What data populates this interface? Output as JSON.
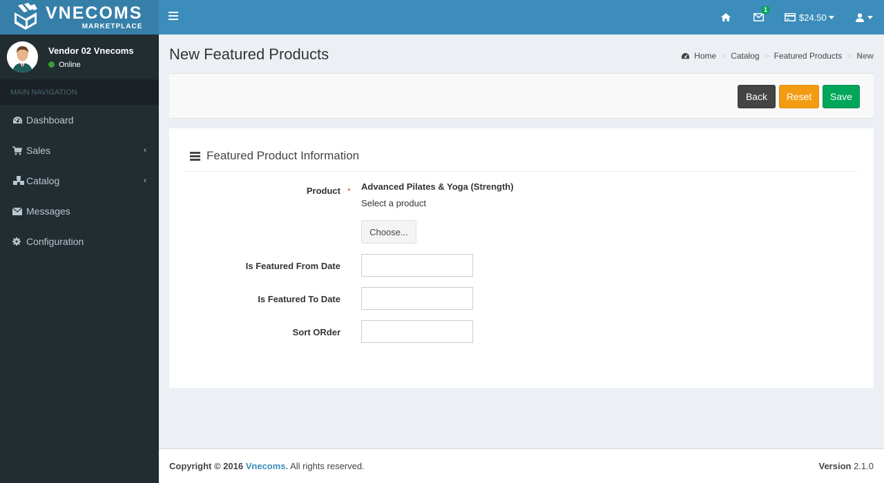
{
  "brand": {
    "title": "VNECOMS",
    "subtitle": "MARKETPLACE"
  },
  "user": {
    "name": "Vendor 02 Vnecoms",
    "status": "Online"
  },
  "sidebar": {
    "header": "MAIN NAVIGATION",
    "items": [
      {
        "label": "Dashboard",
        "icon": "dashboard-icon",
        "has_children": false
      },
      {
        "label": "Sales",
        "icon": "cart-icon",
        "has_children": true
      },
      {
        "label": "Catalog",
        "icon": "cubes-icon",
        "has_children": true
      },
      {
        "label": "Messages",
        "icon": "envelope-icon",
        "has_children": false
      },
      {
        "label": "Configuration",
        "icon": "gear-icon",
        "has_children": false
      }
    ]
  },
  "topbar": {
    "messages_count": "1",
    "balance": "$24.50"
  },
  "page": {
    "title": "New Featured Products",
    "breadcrumb": [
      "Home",
      "Catalog",
      "Featured Products",
      "New"
    ]
  },
  "actions": {
    "back": "Back",
    "reset": "Reset",
    "save": "Save"
  },
  "form": {
    "section_title": "Featured Product Information",
    "product_label": "Product",
    "required_mark": "*",
    "product_value": "Advanced Pilates & Yoga (Strength)",
    "product_hint": "Select a product",
    "choose_label": "Choose...",
    "from_date_label": "Is Featured From Date",
    "from_date_value": "",
    "to_date_label": "Is Featured To Date",
    "to_date_value": "",
    "sort_order_label": "Sort ORder",
    "sort_order_value": ""
  },
  "footer": {
    "copyright_prefix": "Copyright © 2016",
    "brand": "Vnecoms.",
    "rights": "All rights reserved.",
    "version_label": "Version",
    "version_value": "2.1.0"
  },
  "colors": {
    "header": "#3c8dbc",
    "logo_bg": "#367fa9",
    "sidebar": "#222d32",
    "back": "#444444",
    "reset": "#f39c12",
    "save": "#00a65a",
    "required": "#dd4b39"
  }
}
